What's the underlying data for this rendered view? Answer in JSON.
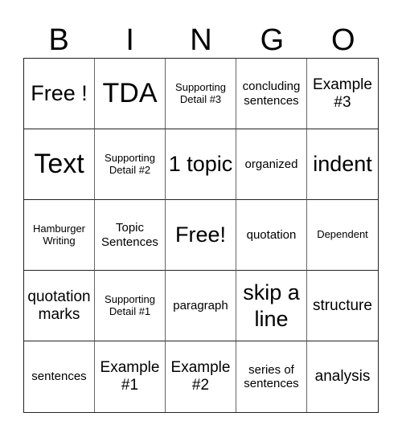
{
  "header": {
    "letters": [
      "B",
      "I",
      "N",
      "G",
      "O"
    ]
  },
  "cells": [
    {
      "text": "Free !",
      "size": "lg"
    },
    {
      "text": "TDA",
      "size": "xl"
    },
    {
      "text": "Supporting Detail #3",
      "size": "xs"
    },
    {
      "text": "concluding sentences",
      "size": "sm"
    },
    {
      "text": "Example #3",
      "size": "md"
    },
    {
      "text": "Text",
      "size": "xl"
    },
    {
      "text": "Supporting Detail #2",
      "size": "xs"
    },
    {
      "text": "1 topic",
      "size": "lg"
    },
    {
      "text": "organized",
      "size": "sm"
    },
    {
      "text": "indent",
      "size": "lg"
    },
    {
      "text": "Hamburger Writing",
      "size": "xs"
    },
    {
      "text": "Topic Sentences",
      "size": "sm"
    },
    {
      "text": "Free!",
      "size": "lg"
    },
    {
      "text": "quotation",
      "size": "sm"
    },
    {
      "text": "Dependent",
      "size": "xs"
    },
    {
      "text": "quotation marks",
      "size": "md"
    },
    {
      "text": "Supporting Detail #1",
      "size": "xs"
    },
    {
      "text": "paragraph",
      "size": "sm"
    },
    {
      "text": "skip a line",
      "size": "lg"
    },
    {
      "text": "structure",
      "size": "md"
    },
    {
      "text": "sentences",
      "size": "sm"
    },
    {
      "text": "Example #1",
      "size": "md"
    },
    {
      "text": "Example #2",
      "size": "md"
    },
    {
      "text": "series of sentences",
      "size": "sm"
    },
    {
      "text": "analysis",
      "size": "md"
    }
  ]
}
